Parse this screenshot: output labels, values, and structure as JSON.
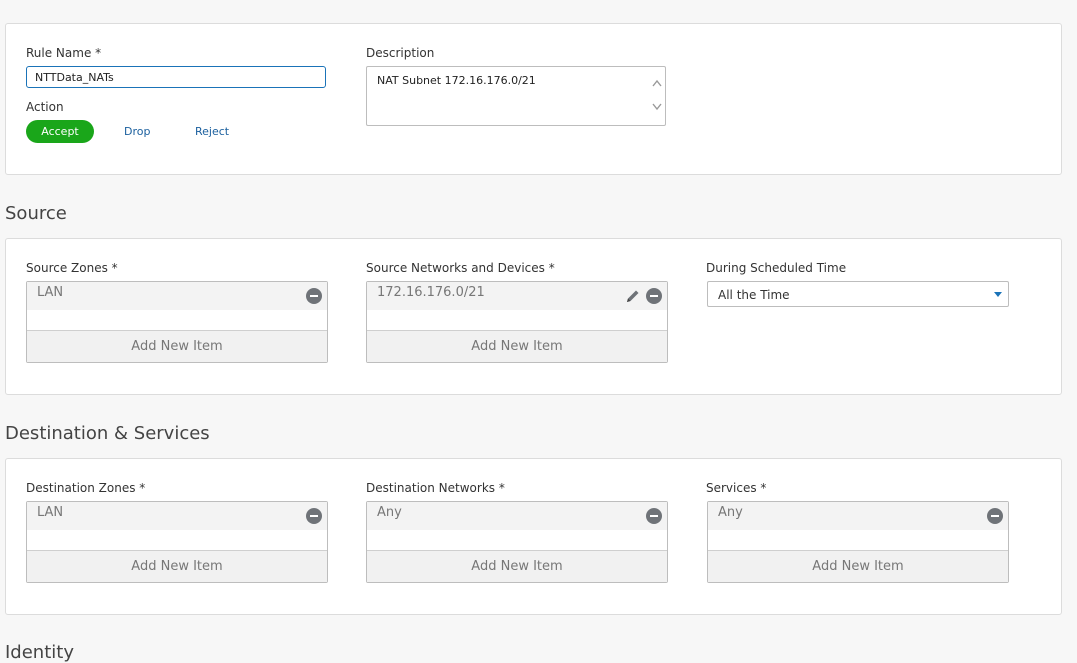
{
  "general": {
    "rule_name_label": "Rule Name *",
    "rule_name_value": "NTTData_NATs",
    "description_label": "Description",
    "description_value": "NAT Subnet 172.16.176.0/21",
    "action_label": "Action",
    "actions": [
      "Accept",
      "Drop",
      "Reject"
    ],
    "selected_action": "Accept"
  },
  "source": {
    "title": "Source",
    "zones_label": "Source Zones *",
    "zones_items": [
      "LAN"
    ],
    "networks_label": "Source Networks and Devices *",
    "networks_items": [
      "172.16.176.0/21"
    ],
    "schedule_label": "During Scheduled Time",
    "schedule_value": "All the Time",
    "add_new_item": "Add New Item"
  },
  "destination": {
    "title": "Destination & Services",
    "zones_label": "Destination Zones *",
    "zones_items": [
      "LAN"
    ],
    "networks_label": "Destination Networks *",
    "networks_items": [
      "Any"
    ],
    "services_label": "Services *",
    "services_items": [
      "Any"
    ],
    "add_new_item": "Add New Item"
  },
  "identity": {
    "title": "Identity"
  },
  "colors": {
    "accent": "#1aa61a",
    "link": "#1a5f9e",
    "focus_border": "#1a73b8"
  },
  "icons": {
    "remove": "minus-circle-icon",
    "edit": "pencil-icon",
    "dropdown": "caret-down-icon"
  }
}
